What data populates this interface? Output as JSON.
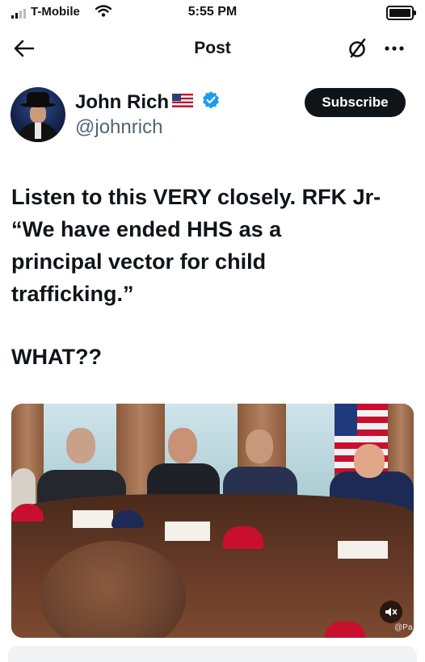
{
  "status_bar": {
    "carrier": "T-Mobile",
    "time": "5:55 PM",
    "signal_icon": "signal-bars-icon",
    "wifi_icon": "wifi-icon",
    "battery_icon": "battery-icon"
  },
  "nav": {
    "title": "Post",
    "back_icon": "back-arrow-icon",
    "grok_icon": "slashed-circle-icon",
    "more_icon": "more-options-icon"
  },
  "author": {
    "display_name": "John Rich",
    "handle": "@johnrich",
    "flag_icon": "us-flag-icon",
    "verified_icon": "verified-badge-icon",
    "subscribe_label": "Subscribe"
  },
  "post": {
    "lines": [
      "Listen to this VERY closely. RFK Jr-",
      "“We have ended HHS as a",
      "principal vector for child",
      "trafficking.”"
    ],
    "closing": "WHAT??"
  },
  "media": {
    "mute_icon": "speaker-muted-icon",
    "watermark": "@Pa"
  },
  "colors": {
    "text": "#0f1419",
    "secondary": "#536471",
    "verified": "#1d9bf0",
    "button": "#0f1419"
  }
}
